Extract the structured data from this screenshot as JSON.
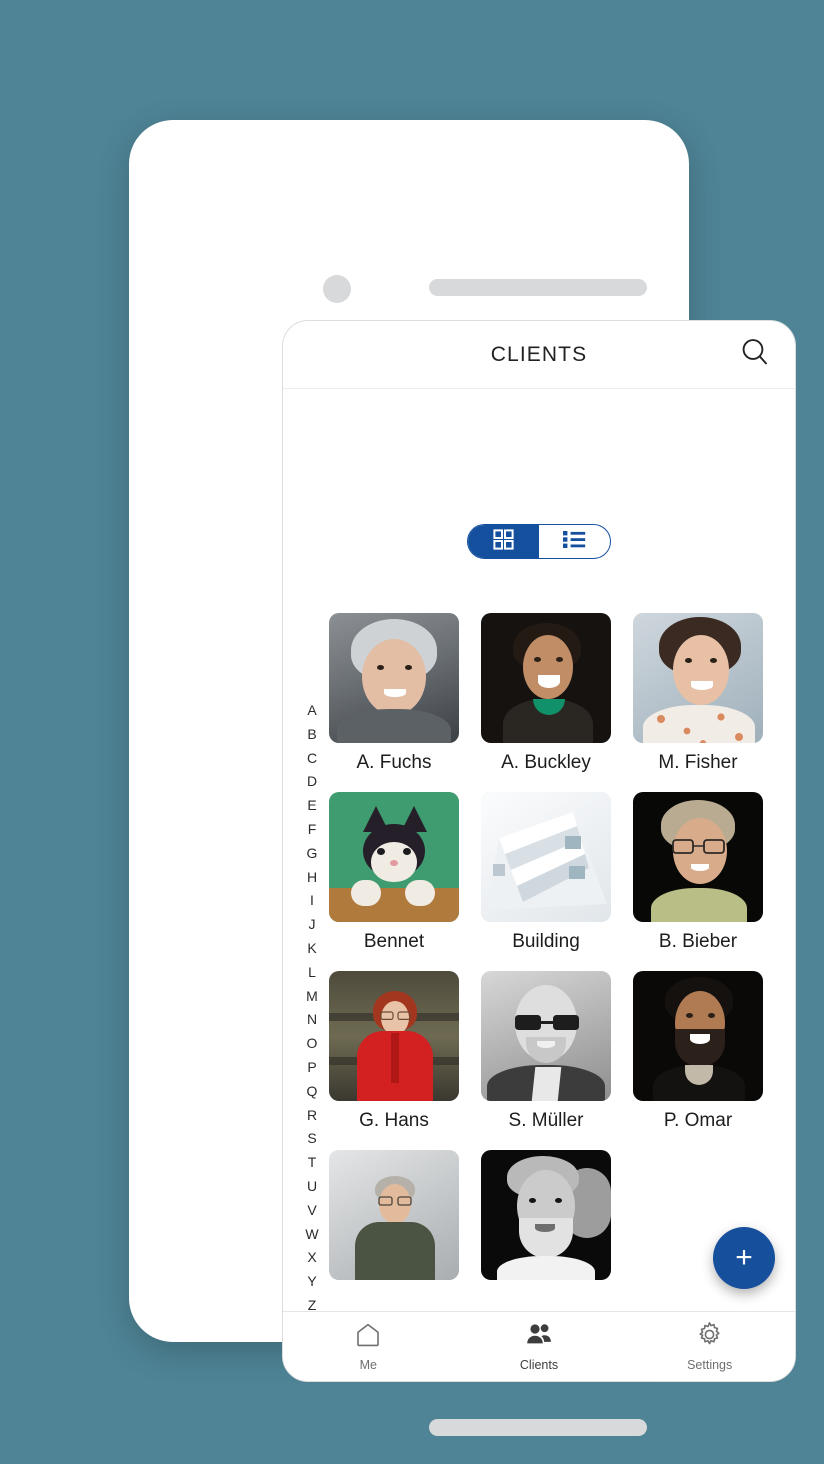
{
  "theme": {
    "page_background": "#4E8496",
    "accent_blue": "#14509E",
    "fab_blue": "#164F9C",
    "phone_body": "#FFFFFF",
    "divider": "#ECECEC",
    "text_primary": "#1D1D1D",
    "text_muted": "#6F6F6F"
  },
  "device": {
    "camera_icon": "camera-dot",
    "speaker_icon": "speaker-grille",
    "home_indicator_icon": "home-indicator-bar",
    "volume_button": "side-button-volume",
    "power_button": "side-button-power"
  },
  "header": {
    "title": "CLIENTS",
    "search_icon": "search-icon"
  },
  "view_toggle": {
    "options": [
      {
        "id": "grid",
        "icon": "grid-view-icon",
        "label": "Grid view",
        "active": true
      },
      {
        "id": "list",
        "icon": "list-view-icon",
        "label": "List view",
        "active": false
      }
    ]
  },
  "alphabet_index": {
    "letters": [
      "A",
      "B",
      "C",
      "D",
      "E",
      "F",
      "G",
      "H",
      "I",
      "J",
      "K",
      "L",
      "M",
      "N",
      "O",
      "P",
      "Q",
      "R",
      "S",
      "T",
      "U",
      "V",
      "W",
      "X",
      "Y",
      "Z"
    ]
  },
  "contacts": [
    {
      "name": "A. Fuchs",
      "thumb": "portrait-elderly-woman-grey-hair"
    },
    {
      "name": "A. Buckley",
      "thumb": "portrait-laughing-woman-dark-bg"
    },
    {
      "name": "M. Fisher",
      "thumb": "portrait-smiling-woman-floral"
    },
    {
      "name": "Bennet",
      "thumb": "photo-cat-green-background"
    },
    {
      "name": "Building",
      "thumb": "photo-white-apartment-building"
    },
    {
      "name": "B. Bieber",
      "thumb": "portrait-woman-glasses-dark-bg"
    },
    {
      "name": "G. Hans",
      "thumb": "portrait-woman-red-coat"
    },
    {
      "name": "S. Müller",
      "thumb": "portrait-bald-man-glasses-bw"
    },
    {
      "name": "P. Omar",
      "thumb": "portrait-bearded-man-dark-bg"
    },
    {
      "name": "",
      "thumb": "portrait-man-glasses-grey-bg"
    },
    {
      "name": "",
      "thumb": "portrait-older-man-bw"
    }
  ],
  "fab": {
    "icon": "plus-icon",
    "label": "Add client"
  },
  "bottom_nav": {
    "items": [
      {
        "id": "me",
        "label": "Me",
        "icon": "home-icon",
        "active": false
      },
      {
        "id": "clients",
        "label": "Clients",
        "icon": "people-icon",
        "active": true
      },
      {
        "id": "settings",
        "label": "Settings",
        "icon": "gear-icon",
        "active": false
      }
    ]
  }
}
